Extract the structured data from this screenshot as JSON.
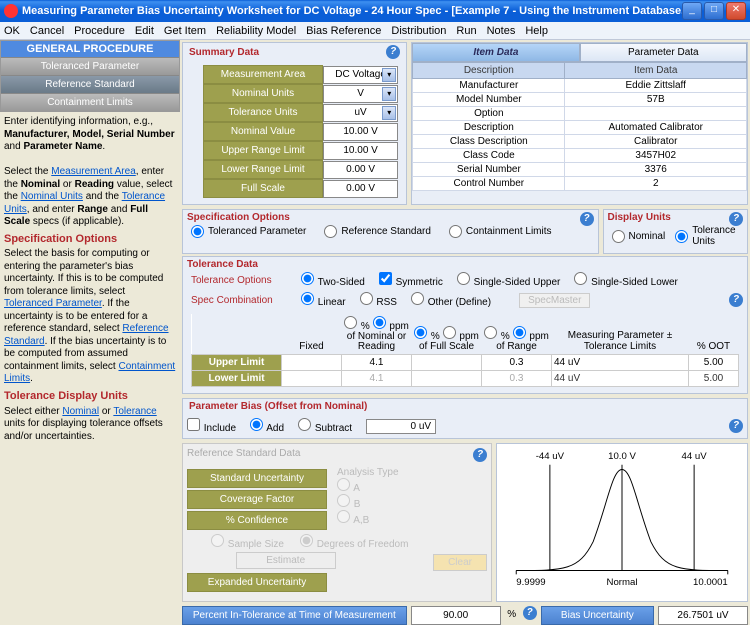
{
  "title": "Measuring Parameter Bias Uncertainty Worksheet for DC Voltage - 24 Hour Spec - [Example 7 - Using the Instrument Database.unc]",
  "menu": [
    "OK",
    "Cancel",
    "Procedure",
    "Edit",
    "Get Item",
    "Reliability Model",
    "Bias Reference",
    "Distribution",
    "Run",
    "Notes",
    "Help"
  ],
  "procedure": {
    "header": "GENERAL  PROCEDURE",
    "items": [
      "Toleranced  Parameter",
      "Reference  Standard",
      "Containment  Limits"
    ]
  },
  "left_instr": {
    "p1": "Enter identifying information, e.g., ",
    "p1b": "Manufacturer, Model, Serial Number",
    "p1c": " and ",
    "p1d": "Parameter Name",
    "p2a": "Select the ",
    "link1": "Measurement Area",
    "p2b": ", enter the ",
    "p2c": "Nominal",
    "p2d": " or ",
    "p2e": "Reading",
    "p2f": " value, select the ",
    "link2": "Nominal Units",
    "p2g": " and the ",
    "link3": "Tolerance Units",
    "p2h": ", and enter ",
    "p2i": "Range",
    "p2j": " and ",
    "p2k": "Full Scale",
    "p2l": " specs (if applicable).",
    "sec1": "Specification Options",
    "sec1body_a": "Select the basis for computing or entering the parameter's bias uncertainty.  If this is to be computed from tolerance limits, select ",
    "sec1link1": "Toleranced Parameter",
    "sec1body_b": ".  If the uncertainty is to be entered for a reference standard, select ",
    "sec1link2": "Reference Standard",
    "sec1body_c": ".  If the bias uncertainty is to be computed from assumed containment limits, select ",
    "sec1link3": "Containment Limits",
    "sec1body_d": ".",
    "sec2": "Tolerance Display Units",
    "sec2body_a": "Select either ",
    "sec2link1": "Nominal",
    "sec2body_b": " or ",
    "sec2link2": "Tolerance",
    "sec2body_c": " units for displaying tolerance offsets and/or uncertainties."
  },
  "summary": {
    "header": "Summary Data",
    "rows": [
      {
        "label": "Measurement Area",
        "value": "DC Voltage",
        "dropdown": true
      },
      {
        "label": "Nominal Units",
        "value": "V",
        "dropdown": true
      },
      {
        "label": "Tolerance Units",
        "value": "uV",
        "dropdown": true
      },
      {
        "label": "Nominal Value",
        "value": "10.00 V",
        "dropdown": false
      },
      {
        "label": "Upper Range Limit",
        "value": "10.00 V",
        "dropdown": false
      },
      {
        "label": "Lower Range Limit",
        "value": "0.00 V",
        "dropdown": false
      },
      {
        "label": "Full Scale",
        "value": "0.00 V",
        "dropdown": false
      }
    ]
  },
  "itemdata": {
    "tabs": [
      "Item Data",
      "Parameter Data"
    ],
    "th": [
      "Description",
      "Item Data"
    ],
    "rows": [
      [
        "Manufacturer",
        "Eddie Zittslaff"
      ],
      [
        "Model Number",
        "57B"
      ],
      [
        "Option",
        ""
      ],
      [
        "Description",
        "Automated Calibrator"
      ],
      [
        "Class Description",
        "Calibrator"
      ],
      [
        "Class Code",
        "3457H02"
      ],
      [
        "Serial Number",
        "3376"
      ],
      [
        "Control Number",
        "2"
      ]
    ]
  },
  "specopts": {
    "header": "Specification Options",
    "opts": [
      "Toleranced Parameter",
      "Reference Standard",
      "Containment Limits"
    ]
  },
  "dispunits": {
    "header": "Display Units",
    "opts": [
      "Nominal",
      "Tolerance Units"
    ]
  },
  "tolerancedata": {
    "header": "Tolerance Data",
    "tolopts_label": "Tolerance Options",
    "tolopts": [
      "Two-Sided",
      "Symmetric",
      "Single-Sided Upper",
      "Single-Sided Lower"
    ],
    "speccomb_label": "Spec Combination",
    "speccomb": [
      "Linear",
      "RSS",
      "Other (Define)"
    ],
    "specmaster": "SpecMaster",
    "cols": {
      "fixed": "Fixed",
      "pct_nom_a": "%",
      "pct_nom_b": "ppm",
      "pct_nom_c": "of Nominal or Reading",
      "pct_fs_a": "%",
      "pct_fs_b": "ppm",
      "pct_fs_c": "of Full Scale",
      "pct_rng_a": "%",
      "pct_rng_b": "ppm",
      "pct_rng_c": "of Range",
      "measparam": "Measuring Parameter ± Tolerance Limits",
      "oot": "% OOT"
    },
    "ul_label": "Upper Limit",
    "ll_label": "Lower Limit",
    "ul": {
      "fixed": "",
      "nom": "4.1",
      "fs": "",
      "rng": "0.3",
      "meas": "44 uV",
      "oot": "5.00"
    },
    "ll": {
      "fixed": "",
      "nom": "4.1",
      "fs": "",
      "rng": "0.3",
      "meas": "44 uV",
      "oot": "5.00"
    }
  },
  "bias": {
    "header": "Parameter Bias (Offset from Nominal)",
    "include": "Include",
    "add": "Add",
    "sub": "Subtract",
    "val": "0 uV"
  },
  "refstd": {
    "header": "Reference Standard Data",
    "btns": [
      "Standard Uncertainty",
      "Coverage Factor",
      "% Confidence"
    ],
    "ssize": "Sample Size",
    "dof": "Degrees of Freedom",
    "est": "Estimate",
    "exp": "Expanded Uncertainty",
    "atype": "Analysis Type",
    "ab": [
      "A",
      "B",
      "A,B"
    ],
    "clear": "Clear"
  },
  "graph": {
    "left": "-44 uV",
    "center": "10.0 V",
    "right": "44 uV",
    "xl": "9.9999",
    "xm": "Normal",
    "xr": "10.0001"
  },
  "footer": {
    "pct_label": "Percent In-Tolerance at Time of Measurement",
    "pct_val": "90.00",
    "pct_unit": "%",
    "bias_label": "Bias Uncertainty",
    "bias_val": "26.7501 uV"
  }
}
